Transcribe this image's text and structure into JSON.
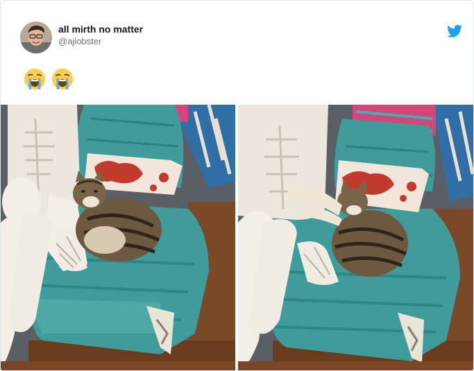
{
  "tweet": {
    "display_name": "all mirth no matter",
    "handle": "@ajlobster",
    "text_emojis": [
      "loudly-crying-face",
      "loudly-crying-face"
    ],
    "icons": [
      "twitter-bird-icon"
    ],
    "colors": {
      "twitter_blue": "#1da1f2",
      "name": "#14171a",
      "handle": "#657786",
      "chair_teal": "#3f9c9a"
    }
  },
  "media": {
    "photos": [
      {
        "content": "cat-curled-on-teal-armchair"
      },
      {
        "content": "cat-stretching-on-teal-armchair"
      }
    ]
  }
}
